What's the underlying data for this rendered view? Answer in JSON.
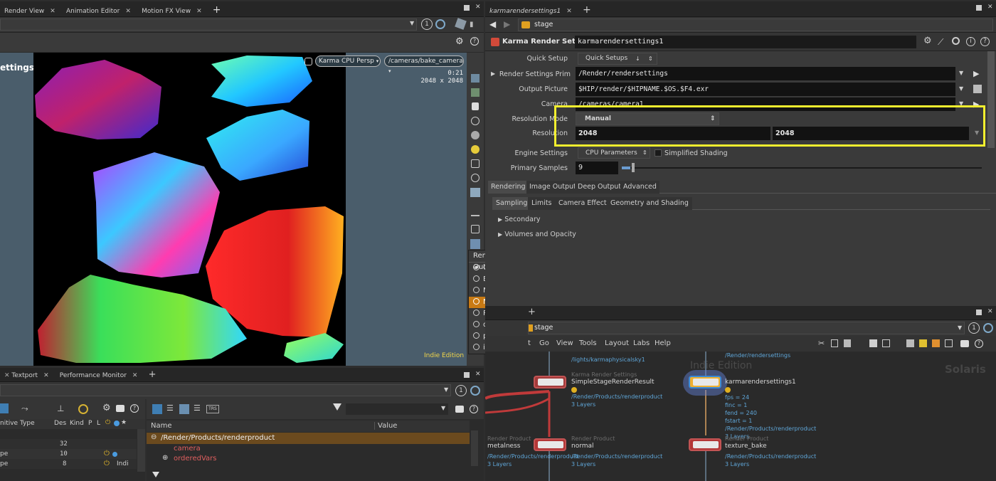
{
  "left_tabs": [
    "Render View",
    "Animation Editor",
    "Motion FX View"
  ],
  "viewport": {
    "heading": "ettings",
    "renderer": "Karma CPU",
    "view": "Persp",
    "camera": "/cameras/bake_camera",
    "time": "0:21",
    "resolution": "2048 x 2048",
    "watermark": "Indie Edition",
    "page_number": "1"
  },
  "render_outputs": {
    "title": "Render Outputs",
    "items": [
      "C",
      "BC",
      "MT",
      "NM",
      "RO",
      "depth",
      "primId",
      "instanceId"
    ],
    "selected": "C",
    "highlighted": "NM"
  },
  "bottom_left_tabs": [
    "Textport",
    "Performance Monitor"
  ],
  "scene_graph": {
    "page_number": "1",
    "columns": [
      "nitive Type",
      "Des",
      "Kind",
      "P",
      "L"
    ],
    "rows": [
      {
        "type": "",
        "des": "32"
      },
      {
        "type": "pe",
        "des": "10"
      },
      {
        "type": "pe",
        "des": "8",
        "extra": "Indi"
      }
    ]
  },
  "details": {
    "columns": [
      "Name",
      "Value"
    ],
    "root": "/Render/Products/renderproduct",
    "children": [
      "camera",
      "orderedVars"
    ],
    "trs_label": "TRS"
  },
  "params_panel": {
    "tab": "karmarendersettings1",
    "path": "stage",
    "node_type": "Karma Render Settings",
    "node_name": "karmarendersettings1",
    "fields": {
      "quick_setup_label": "Quick Setup",
      "quick_setup_value": "Quick Setups",
      "render_settings_prim_label": "Render Settings Prim",
      "render_settings_prim_value": "/Render/rendersettings",
      "output_picture_label": "Output Picture",
      "output_picture_value": "$HIP/render/$HIPNAME.$OS.$F4.exr",
      "camera_label": "Camera",
      "camera_value": "/cameras/camera1",
      "resolution_mode_label": "Resolution Mode",
      "resolution_mode_value": "Manual",
      "resolution_label": "Resolution",
      "resolution_x": "2048",
      "resolution_y": "2048",
      "engine_settings_label": "Engine Settings",
      "engine_settings_value": "CPU Parameters",
      "simplified_shading_label": "Simplified Shading",
      "primary_samples_label": "Primary Samples",
      "primary_samples_value": "9"
    },
    "tabs": [
      "Rendering",
      "Image Output",
      "Deep Output",
      "Advanced"
    ],
    "subtabs": [
      "Sampling",
      "Limits",
      "Camera Effects",
      "Geometry and Shading"
    ],
    "sections": [
      "Secondary",
      "Volumes and Opacity"
    ],
    "highlight_color": "#f2ee2e"
  },
  "network": {
    "path": "stage",
    "page_number": "1",
    "menu": [
      "t",
      "Go",
      "View",
      "Tools",
      "Layout",
      "Labs",
      "Help"
    ],
    "context_label": "Solaris",
    "watermark": "Indie Edition",
    "nodes": {
      "top_left_label": "/lights/karmaphysicalsky1",
      "top_right_label": "/Render/rendersettings",
      "ssrr_type": "Karma Render Settings",
      "ssrr_name": "SimpleStageRenderResult",
      "ssrr_sub1": "/Render/Products/renderproduct",
      "ssrr_sub2": "3 Layers",
      "krs_name": "karmarendersettings1",
      "krs_info": [
        "fps = 24",
        "finc = 1",
        "fend = 240",
        "fstart = 1",
        "/Render/Products/renderproduct",
        "3 Layers"
      ],
      "rp1_type": "Render Product",
      "rp1_name": "metalness",
      "rp1_sub": "/Render/Products/renderproduct",
      "rp1_layers": "3 Layers",
      "rp2_type": "Render Product",
      "rp2_name": "normal",
      "rp2_sub": "/Render/Products/renderproduct",
      "rp2_layers": "3 Layers",
      "rp3_type": "Render Product",
      "rp3_name": "texture_bake",
      "rp3_sub": "/Render/Products/renderproduct",
      "rp3_layers": "3 Layers"
    }
  }
}
